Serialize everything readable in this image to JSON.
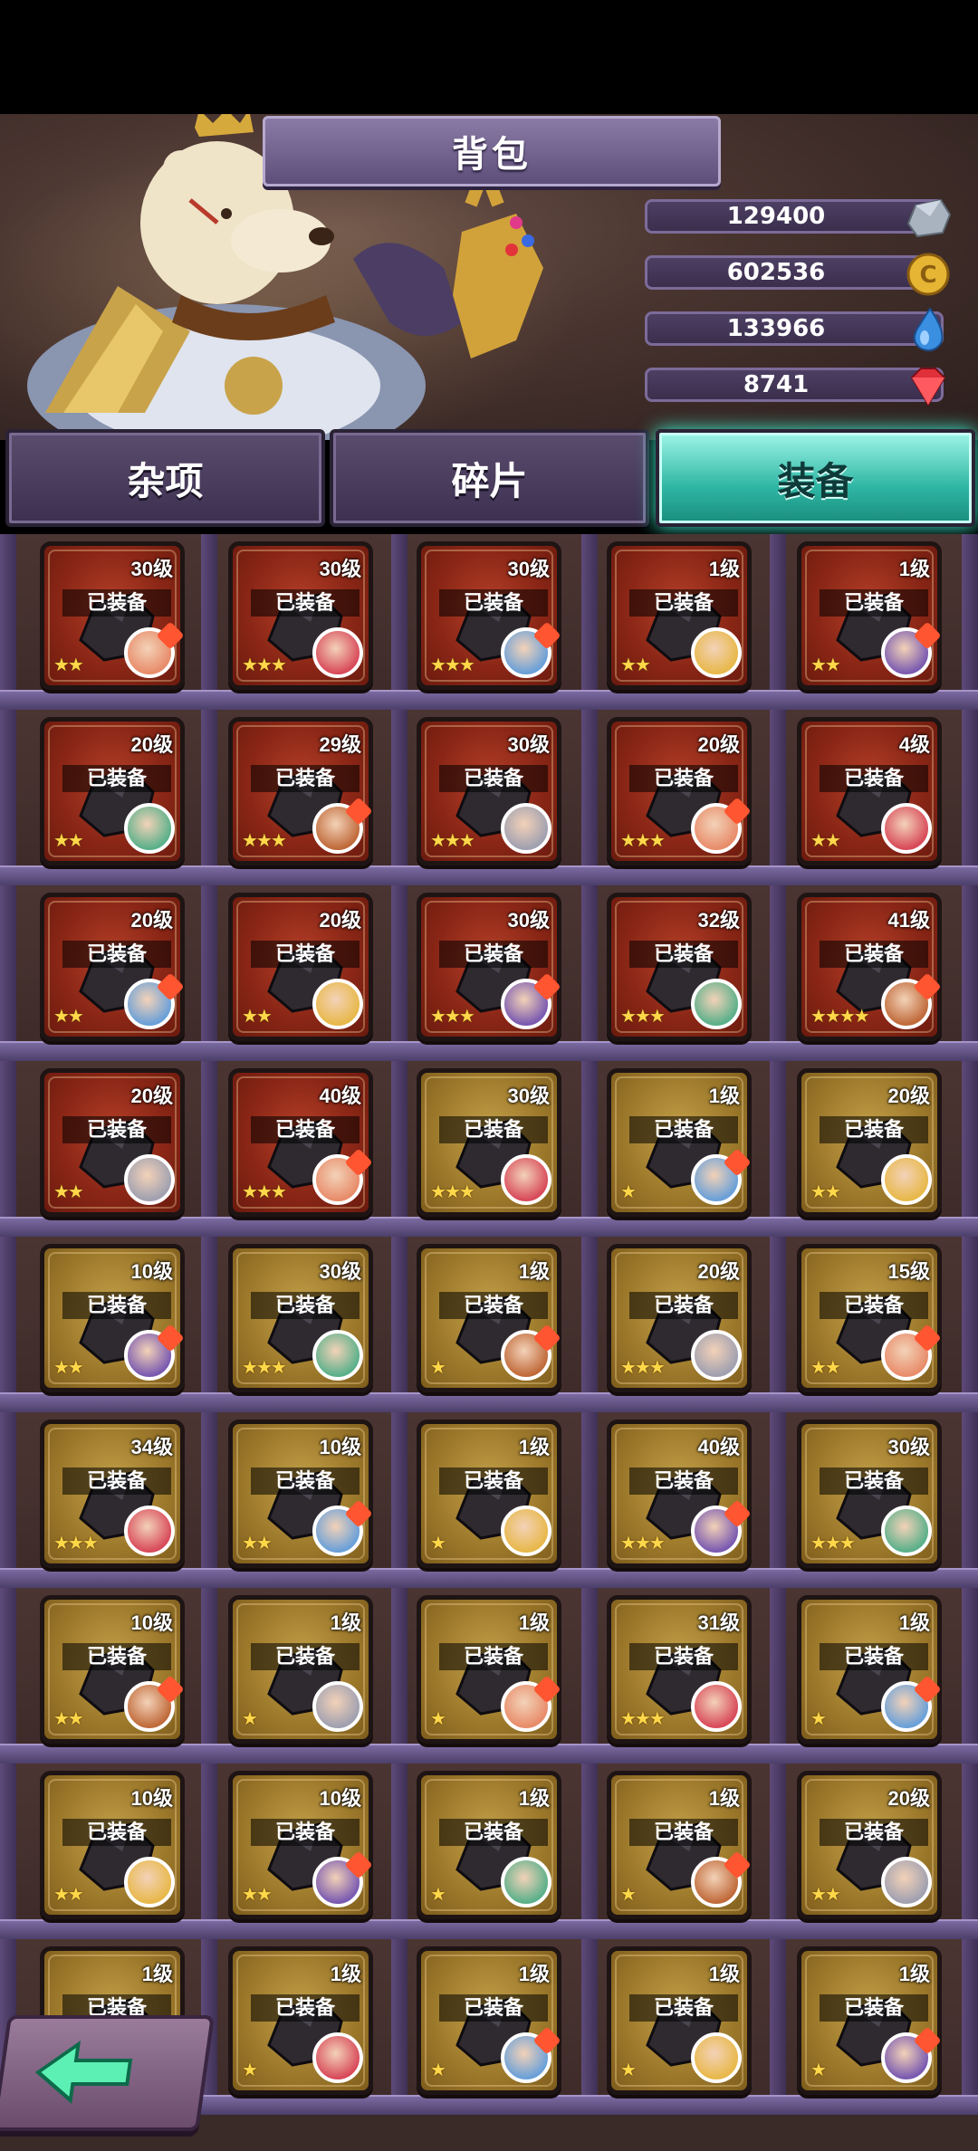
{
  "window": {
    "title": "背包"
  },
  "currencies": [
    {
      "name": "stone",
      "value": "129400",
      "icon": "stone-icon",
      "color": "#9aa6b2"
    },
    {
      "name": "gold",
      "value": "602536",
      "icon": "gold-coin-icon",
      "color": "#e6b534"
    },
    {
      "name": "water",
      "value": "133966",
      "icon": "water-drop-icon",
      "color": "#3a8fe0"
    },
    {
      "name": "gem",
      "value": "8741",
      "icon": "red-gem-icon",
      "color": "#e0303a"
    }
  ],
  "tabs": [
    {
      "label": "杂项",
      "active": false
    },
    {
      "label": "碎片",
      "active": false
    },
    {
      "label": "装备",
      "active": true
    }
  ],
  "equipped_label": "已装备",
  "rows": [
    [
      {
        "level": "30级",
        "stars": "★★",
        "rarity": "red"
      },
      {
        "level": "30级",
        "stars": "★★★",
        "rarity": "red"
      },
      {
        "level": "30级",
        "stars": "★★★",
        "rarity": "red"
      },
      {
        "level": "1级",
        "stars": "★★",
        "rarity": "red"
      },
      {
        "level": "1级",
        "stars": "★★",
        "rarity": "red"
      }
    ],
    [
      {
        "level": "20级",
        "stars": "★★",
        "rarity": "red"
      },
      {
        "level": "29级",
        "stars": "★★★",
        "rarity": "red"
      },
      {
        "level": "30级",
        "stars": "★★★",
        "rarity": "red"
      },
      {
        "level": "20级",
        "stars": "★★★",
        "rarity": "red"
      },
      {
        "level": "4级",
        "stars": "★★",
        "rarity": "red"
      }
    ],
    [
      {
        "level": "20级",
        "stars": "★★",
        "rarity": "red"
      },
      {
        "level": "20级",
        "stars": "★★",
        "rarity": "red"
      },
      {
        "level": "30级",
        "stars": "★★★",
        "rarity": "red"
      },
      {
        "level": "32级",
        "stars": "★★★",
        "rarity": "red"
      },
      {
        "level": "41级",
        "stars": "★★★★",
        "rarity": "red"
      }
    ],
    [
      {
        "level": "20级",
        "stars": "★★",
        "rarity": "red"
      },
      {
        "level": "40级",
        "stars": "★★★",
        "rarity": "red"
      },
      {
        "level": "30级",
        "stars": "★★★",
        "rarity": "gold"
      },
      {
        "level": "1级",
        "stars": "★",
        "rarity": "gold"
      },
      {
        "level": "20级",
        "stars": "★★",
        "rarity": "gold"
      }
    ],
    [
      {
        "level": "10级",
        "stars": "★★",
        "rarity": "gold"
      },
      {
        "level": "30级",
        "stars": "★★★",
        "rarity": "gold"
      },
      {
        "level": "1级",
        "stars": "★",
        "rarity": "gold"
      },
      {
        "level": "20级",
        "stars": "★★★",
        "rarity": "gold"
      },
      {
        "level": "15级",
        "stars": "★★",
        "rarity": "gold"
      }
    ],
    [
      {
        "level": "34级",
        "stars": "★★★",
        "rarity": "gold"
      },
      {
        "level": "10级",
        "stars": "★★",
        "rarity": "gold"
      },
      {
        "level": "1级",
        "stars": "★",
        "rarity": "gold"
      },
      {
        "level": "40级",
        "stars": "★★★",
        "rarity": "gold"
      },
      {
        "level": "30级",
        "stars": "★★★",
        "rarity": "gold"
      }
    ],
    [
      {
        "level": "10级",
        "stars": "★★",
        "rarity": "gold"
      },
      {
        "level": "1级",
        "stars": "★",
        "rarity": "gold"
      },
      {
        "level": "1级",
        "stars": "★",
        "rarity": "gold"
      },
      {
        "level": "31级",
        "stars": "★★★",
        "rarity": "gold"
      },
      {
        "level": "1级",
        "stars": "★",
        "rarity": "gold"
      }
    ],
    [
      {
        "level": "10级",
        "stars": "★★",
        "rarity": "gold"
      },
      {
        "level": "10级",
        "stars": "★★",
        "rarity": "gold"
      },
      {
        "level": "1级",
        "stars": "★",
        "rarity": "gold"
      },
      {
        "level": "1级",
        "stars": "★",
        "rarity": "gold"
      },
      {
        "level": "20级",
        "stars": "★★",
        "rarity": "gold"
      }
    ],
    [
      {
        "level": "1级",
        "stars": "★",
        "rarity": "gold"
      },
      {
        "level": "1级",
        "stars": "★",
        "rarity": "gold"
      },
      {
        "level": "1级",
        "stars": "★",
        "rarity": "gold"
      },
      {
        "level": "1级",
        "stars": "★",
        "rarity": "gold"
      },
      {
        "level": "1级",
        "stars": "★",
        "rarity": "gold"
      }
    ]
  ],
  "back_button": {
    "icon": "back-arrow-icon"
  }
}
